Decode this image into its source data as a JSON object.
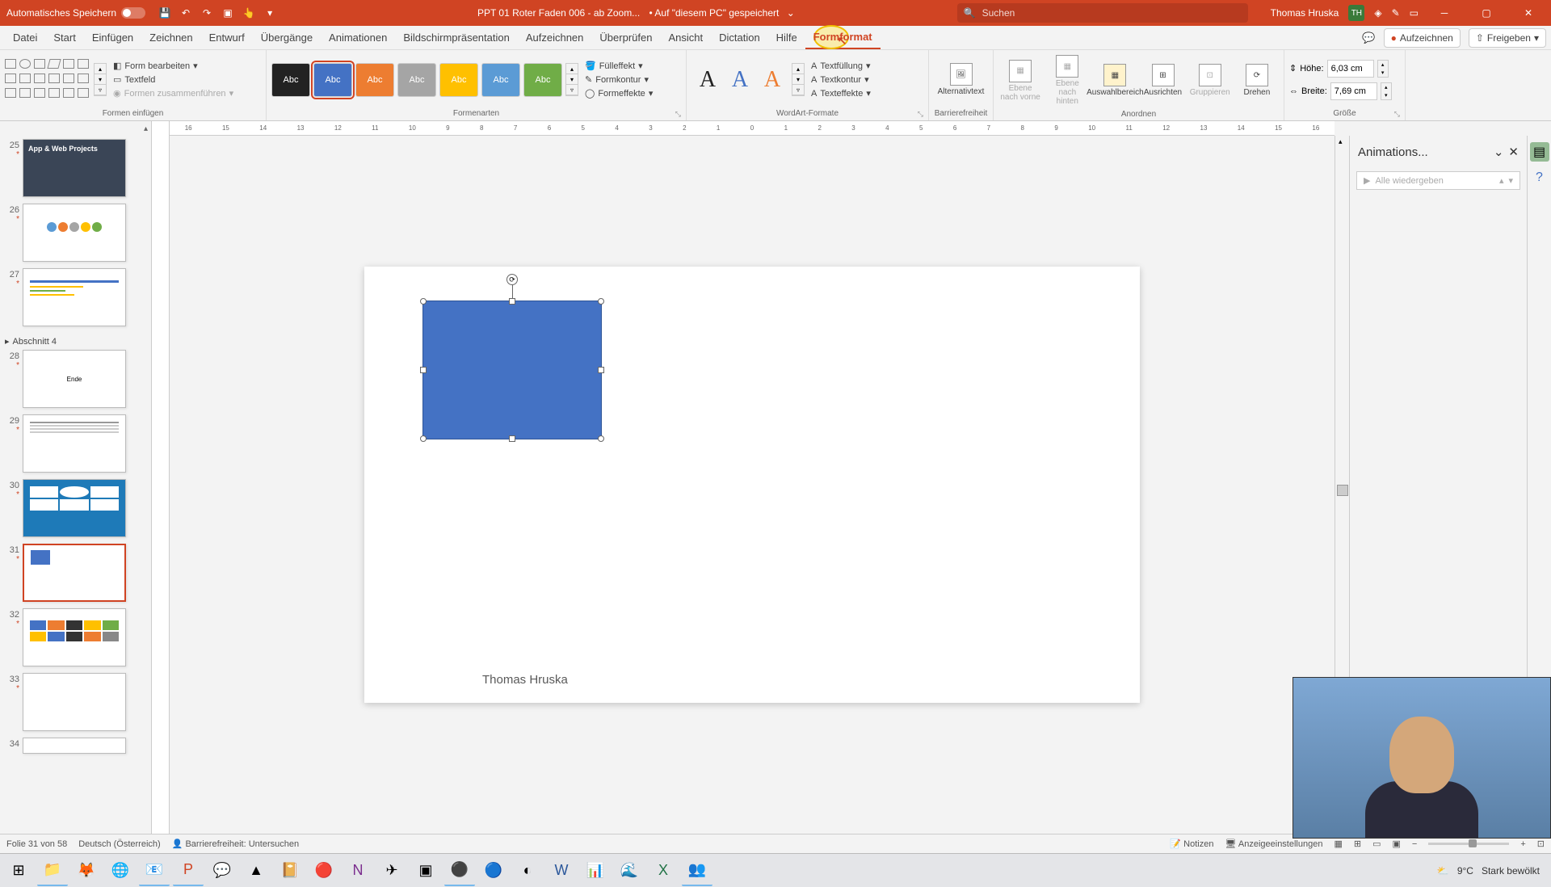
{
  "titlebar": {
    "autosave": "Automatisches Speichern",
    "doc_title": "PPT 01 Roter Faden 006 - ab Zoom...",
    "saved_loc": "• Auf \"diesem PC\" gespeichert",
    "search_placeholder": "Suchen",
    "user_name": "Thomas Hruska",
    "user_initials": "TH"
  },
  "tabs": {
    "items": [
      "Datei",
      "Start",
      "Einfügen",
      "Zeichnen",
      "Entwurf",
      "Übergänge",
      "Animationen",
      "Bildschirmpräsentation",
      "Aufzeichnen",
      "Überprüfen",
      "Ansicht",
      "Dictation",
      "Hilfe",
      "Formformat"
    ],
    "aufzeichnen_btn": "Aufzeichnen",
    "freigeben_btn": "Freigeben"
  },
  "ribbon": {
    "insert_shapes": {
      "label": "Formen einfügen",
      "edit_form": "Form bearbeiten",
      "textfield": "Textfeld",
      "merge": "Formen zusammenführen"
    },
    "shape_styles": {
      "label": "Formenarten",
      "swatch_text": "Abc",
      "fill": "Fülleffekt",
      "outline": "Formkontur",
      "effects": "Formeffekte"
    },
    "wordart": {
      "label": "WordArt-Formate",
      "textfill": "Textfüllung",
      "textoutline": "Textkontur",
      "texteffects": "Texteffekte"
    },
    "accessibility": {
      "label": "Barrierefreiheit",
      "alt": "Alternativtext"
    },
    "arrange": {
      "label": "Anordnen",
      "front": "Ebene nach vorne",
      "back": "Ebene nach hinten",
      "selection": "Auswahlbereich",
      "align": "Ausrichten",
      "group": "Gruppieren",
      "rotate": "Drehen"
    },
    "size": {
      "label": "Größe",
      "height_lbl": "Höhe:",
      "height_val": "6,03 cm",
      "width_lbl": "Breite:",
      "width_val": "7,69 cm"
    }
  },
  "section": {
    "name": "Abschnitt 4"
  },
  "thumbs": {
    "t25": {
      "num": "25",
      "title": "App & Web Projects"
    },
    "t26": "26",
    "t27": "27",
    "t28_label": "Ende",
    "t28": "28",
    "t29": "29",
    "t30": "30",
    "t31": "31",
    "t32": "32",
    "t33": "33",
    "t34": "34"
  },
  "canvas": {
    "author": "Thomas Hruska"
  },
  "anim_pane": {
    "title": "Animations...",
    "play": "Alle wiedergeben"
  },
  "status": {
    "slide": "Folie 31 von 58",
    "lang": "Deutsch (Österreich)",
    "access": "Barrierefreiheit: Untersuchen",
    "notes": "Notizen",
    "display": "Anzeigeeinstellungen"
  },
  "taskbar": {
    "temp": "9°C",
    "weather": "Stark bewölkt"
  },
  "ruler_ticks": [
    "16",
    "15",
    "14",
    "13",
    "12",
    "11",
    "10",
    "9",
    "8",
    "7",
    "6",
    "5",
    "4",
    "3",
    "2",
    "1",
    "0",
    "1",
    "2",
    "3",
    "4",
    "5",
    "6",
    "7",
    "8",
    "9",
    "10",
    "11",
    "12",
    "13",
    "14",
    "15",
    "16"
  ]
}
